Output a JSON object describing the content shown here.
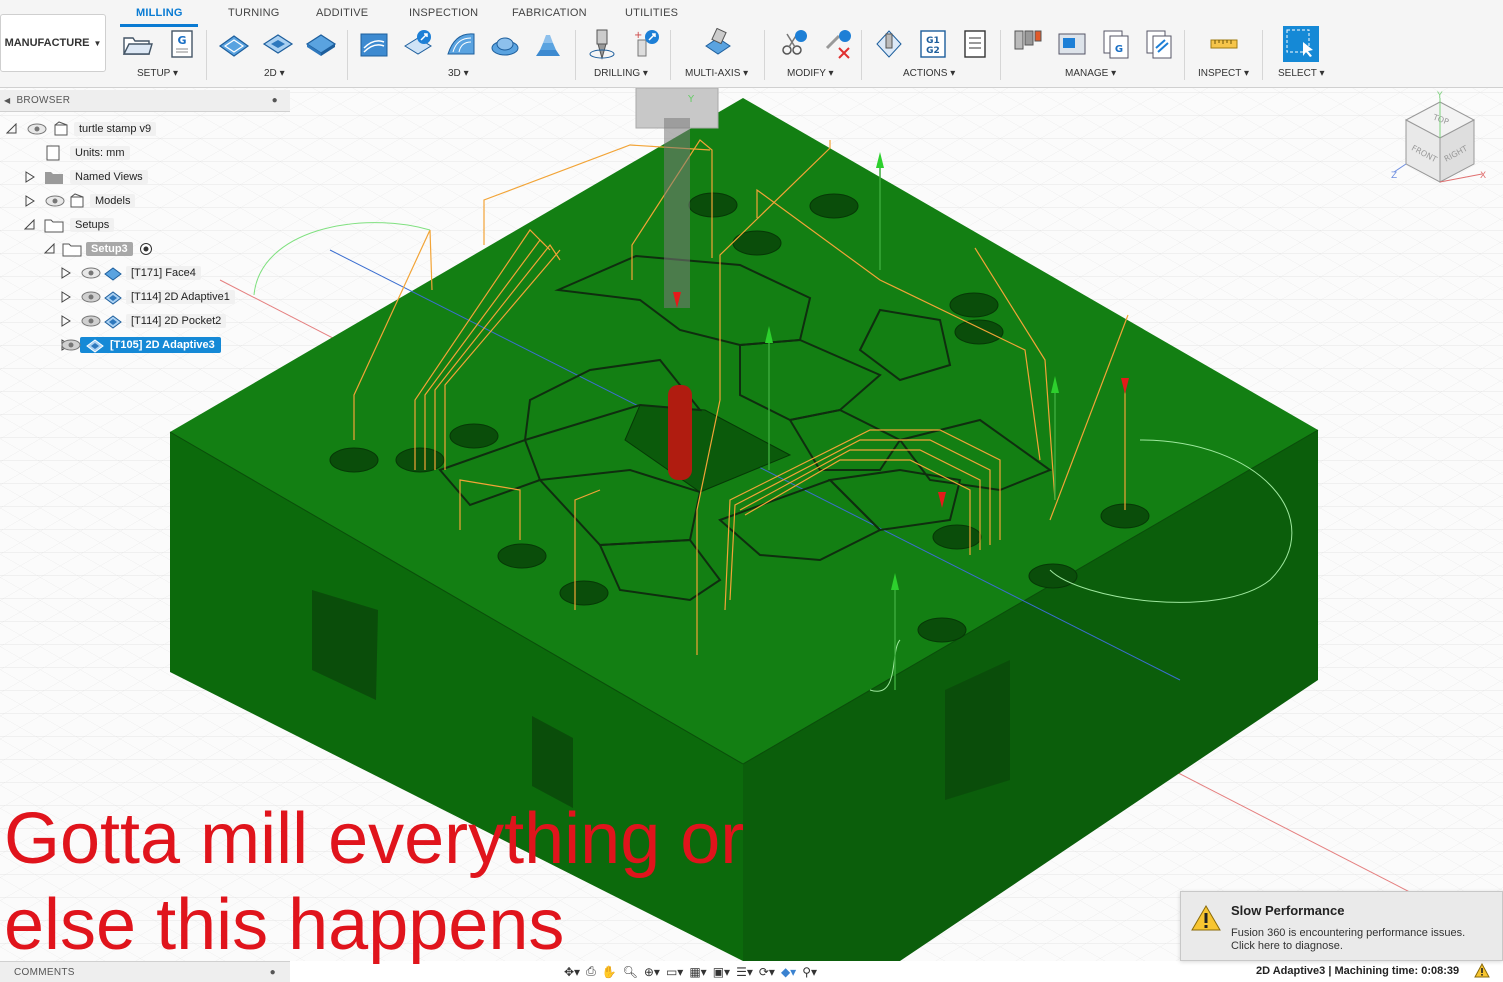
{
  "workspace": {
    "label": "MANUFACTURE"
  },
  "tabs": [
    {
      "label": "MILLING",
      "active": true
    },
    {
      "label": "TURNING"
    },
    {
      "label": "ADDITIVE"
    },
    {
      "label": "INSPECTION"
    },
    {
      "label": "FABRICATION"
    },
    {
      "label": "UTILITIES"
    }
  ],
  "groups": {
    "setup": "SETUP",
    "g2d": "2D",
    "g3d": "3D",
    "drilling": "DRILLING",
    "multi_axis": "MULTI-AXIS",
    "modify": "MODIFY",
    "actions": "ACTIONS",
    "manage": "MANAGE",
    "inspect": "INSPECT",
    "select": "SELECT"
  },
  "browser": {
    "title": "BROWSER",
    "items": [
      {
        "label": "turtle stamp v9"
      },
      {
        "label": "Units: mm"
      },
      {
        "label": "Named Views"
      },
      {
        "label": "Models"
      },
      {
        "label": "Setups"
      },
      {
        "label": "Setup3"
      },
      {
        "label": "[T171] Face4"
      },
      {
        "label": "[T114] 2D Adaptive1"
      },
      {
        "label": "[T114] 2D Pocket2"
      },
      {
        "label": "[T105] 2D Adaptive3"
      }
    ]
  },
  "viewcube": {
    "top": "TOP",
    "front": "FRONT",
    "right": "RIGHT",
    "axis_x": "X",
    "axis_y": "Y",
    "axis_z": "Z"
  },
  "caption": {
    "line1": "Gotta mill everything or",
    "line2": "else this happens"
  },
  "notification": {
    "title": "Slow Performance",
    "line1": "Fusion 360 is encountering performance issues.",
    "line2": "Click here to diagnose."
  },
  "status": {
    "comments": "COMMENTS",
    "operation": "2D Adaptive3 | Machining time: 0:08:39"
  },
  "colors": {
    "accent": "#0a7bd3",
    "stock": "#127f12",
    "selection": "#1589d6",
    "caption": "#e0141c"
  },
  "icons": {
    "nav": [
      "orbit-icon",
      "look-at-icon",
      "pan-icon",
      "zoom-icon",
      "fit-icon",
      "display-settings-icon",
      "grid-icon",
      "viewports-icon",
      "environment-icon",
      "effects-icon",
      "object-visibility-icon",
      "camera-icon"
    ]
  }
}
